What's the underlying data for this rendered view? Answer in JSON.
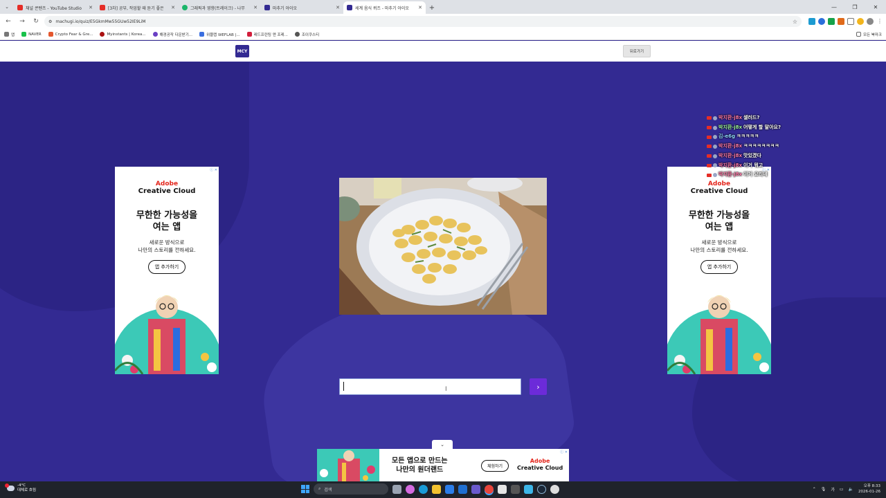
{
  "browser": {
    "tabs": [
      {
        "title": "채널 콘텐츠 - YouTube Studio",
        "color": "#e52d27",
        "active": false
      },
      {
        "title": "[3차] 공부, 작업할 때 듣기 좋은",
        "color": "#e52d27",
        "active": false
      },
      {
        "title": "그래픽과 영향(트레이크) - 나무",
        "color": "#1bb56a",
        "active": false
      },
      {
        "title": "마추기 아이오",
        "color": "#332a92",
        "active": false
      },
      {
        "title": "세계 음식 퀴즈 - 마추기 아이오",
        "color": "#332a92",
        "active": true
      }
    ],
    "new_tab": "+",
    "url": "machugi.io/quiz/E5GkmMw55GUw52IE9LiM",
    "bookmarks": [
      {
        "label": "앱",
        "color": "#777"
      },
      {
        "label": "NAVER",
        "color": "#19c24b"
      },
      {
        "label": "Crypto Fear & Gre...",
        "color": "#e4572e"
      },
      {
        "label": "Myinstants | Korea...",
        "color": "#a11"
      },
      {
        "label": "해경공작 다운받기...",
        "color": "#6a3fc4"
      },
      {
        "label": "위블랩 WEFLAB |...",
        "color": "#3b6fe0"
      },
      {
        "label": "레드프린팅 앤 프레...",
        "color": "#d21f3c"
      },
      {
        "label": "조이쿠스티",
        "color": "#555"
      }
    ],
    "bookmarks_right": "모든 북마크"
  },
  "site": {
    "logo": "MCY",
    "back_button": "뒤로가기"
  },
  "ad_vertical": {
    "brand_line1": "Adobe",
    "brand_line2": "Creative Cloud",
    "headline_line1": "무한한 가능성을",
    "headline_line2": "여는 앱",
    "sub_line1": "새로운 방식으로",
    "sub_line2": "나만의 스토리를 전하세요.",
    "button": "앱 추가하기",
    "adchoice": "ⓘ ✕"
  },
  "quiz": {
    "image_subject": "gnocchi",
    "answer_value": "",
    "submit_symbol": "›"
  },
  "chat": [
    {
      "user": "박지환-j8x",
      "message": "샐러드?",
      "user_class": "cu1"
    },
    {
      "user": "박지환-j8x",
      "message": "어떻게 할 말아요?",
      "user_class": "cu3"
    },
    {
      "user": "김-e6g",
      "message": "ㅋㅋㅋㅋㅋ",
      "user_class": "cu2"
    },
    {
      "user": "박지환-j8x",
      "message": "ㅋㅋㅋㅋㅋㅋㅋㅋ",
      "user_class": "cu1"
    },
    {
      "user": "박지환-j8x",
      "message": "맛있겠다",
      "user_class": "cu1"
    },
    {
      "user": "박지환-j8x",
      "message": "이거 뭐고",
      "user_class": "cu1"
    },
    {
      "user": "박지환-j8x",
      "message": "이거 요리네",
      "user_class": "cu1"
    }
  ],
  "bottom_ad": {
    "headline_line1": "모든 앱으로 만드는",
    "headline_line2": "나만의 원더랜드",
    "button": "체험하기",
    "brand_line1": "Adobe",
    "brand_line2": "Creative Cloud",
    "collapse_symbol": "⌄"
  },
  "taskbar": {
    "weather_temp": "-4°C",
    "weather_text": "대체로 흐림",
    "search_placeholder": "검색",
    "tray_lang": "가",
    "time": "오후 8:33",
    "date": "2026-01-26"
  },
  "colors": {
    "page_bg": "#332a92",
    "accent": "#6c2bd9",
    "adobe_red": "#e3251b"
  }
}
